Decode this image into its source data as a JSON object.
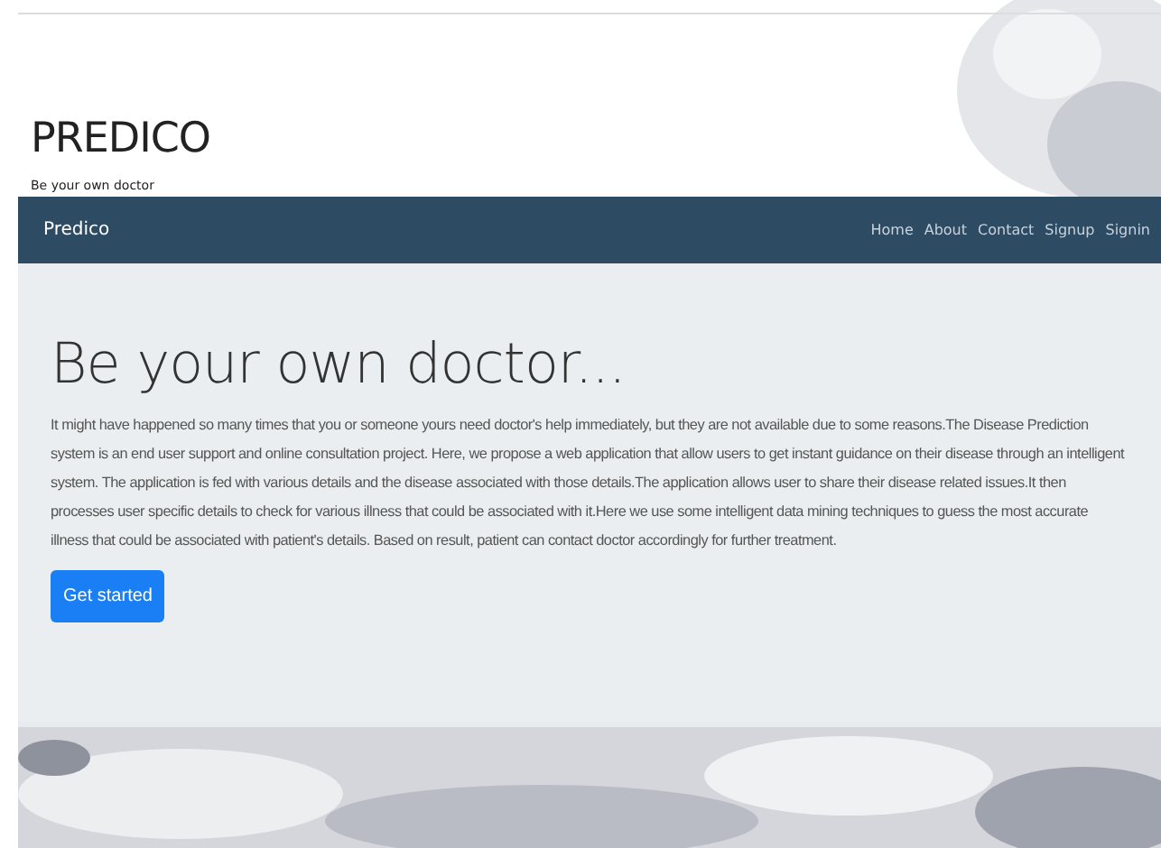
{
  "header": {
    "title": "PREDICO",
    "tagline": "Be your own doctor"
  },
  "navbar": {
    "brand": "Predico",
    "links": [
      "Home",
      "About",
      "Contact",
      "Signup",
      "Signin"
    ]
  },
  "hero": {
    "heading": "Be your own doctor...",
    "text": "It might have happened so many times that you or someone yours need doctor's help immediately, but they are not available due to some reasons.The Disease Prediction system is an end user support and online consultation project. Here, we propose a web application that allow users to get instant guidance on their disease through an intelligent system. The application is fed with various details and the disease associated with those details.The application allows user to share their disease related issues.It then processes user specific details to check for various illness that could be associated with it.Here we use some intelligent data mining techniques to guess the most accurate illness that could be associated with patient's details. Based on result, patient can contact doctor accordingly for further treatment.",
    "button": "Get started"
  }
}
